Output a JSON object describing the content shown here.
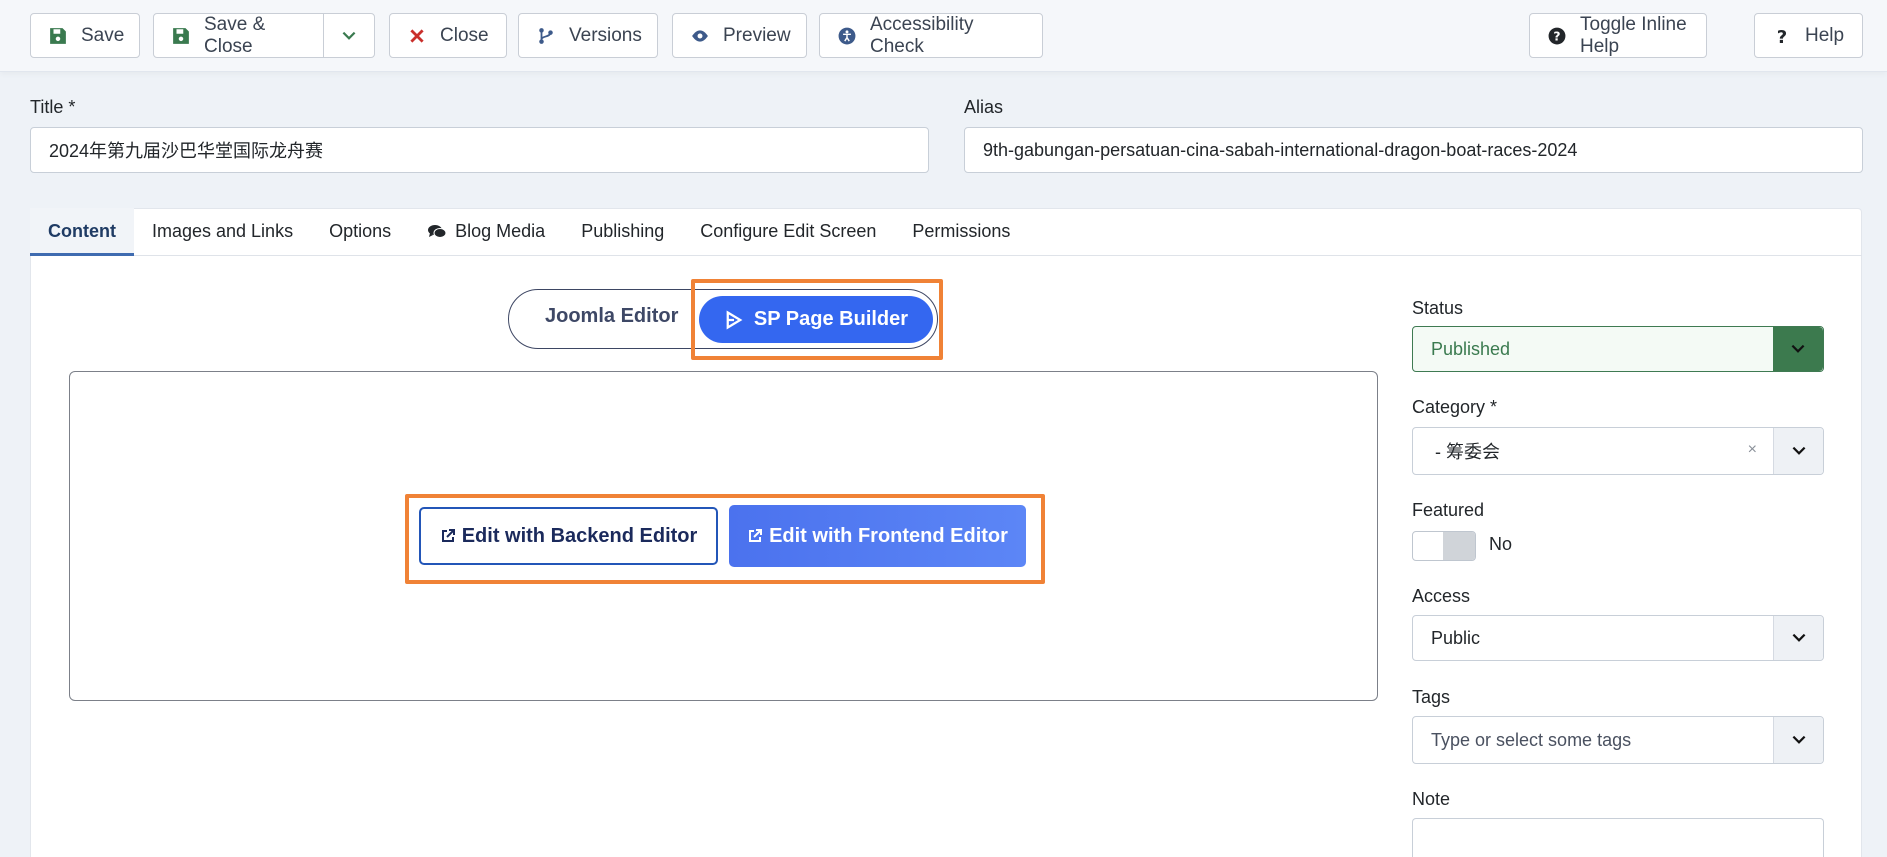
{
  "toolbar": {
    "save": "Save",
    "save_close": "Save & Close",
    "close": "Close",
    "versions": "Versions",
    "preview": "Preview",
    "accessibility": "Accessibility Check",
    "toggle_help": "Toggle Inline Help",
    "help": "Help"
  },
  "form": {
    "title_label": "Title *",
    "title_value": "2024年第九届沙巴华堂国际龙舟赛",
    "alias_label": "Alias",
    "alias_value": "9th-gabungan-persatuan-cina-sabah-international-dragon-boat-races-2024"
  },
  "tabs": [
    {
      "label": "Content",
      "active": true
    },
    {
      "label": "Images and Links"
    },
    {
      "label": "Options"
    },
    {
      "label": "Blog Media"
    },
    {
      "label": "Publishing"
    },
    {
      "label": "Configure Edit Screen"
    },
    {
      "label": "Permissions"
    }
  ],
  "editor_toggle": {
    "joomla": "Joomla Editor",
    "sppb": "SP Page Builder"
  },
  "editor_buttons": {
    "backend": "Edit with Backend Editor",
    "frontend": "Edit with Frontend Editor"
  },
  "sidebar": {
    "status_label": "Status",
    "status_value": "Published",
    "category_label": "Category *",
    "category_value": "- 筹委会",
    "featured_label": "Featured",
    "featured_value": "No",
    "access_label": "Access",
    "access_value": "Public",
    "tags_label": "Tags",
    "tags_placeholder": "Type or select some tags",
    "note_label": "Note"
  },
  "colors": {
    "accent": "#3467f0",
    "highlight": "#f08236",
    "published": "#3c7a4e"
  }
}
